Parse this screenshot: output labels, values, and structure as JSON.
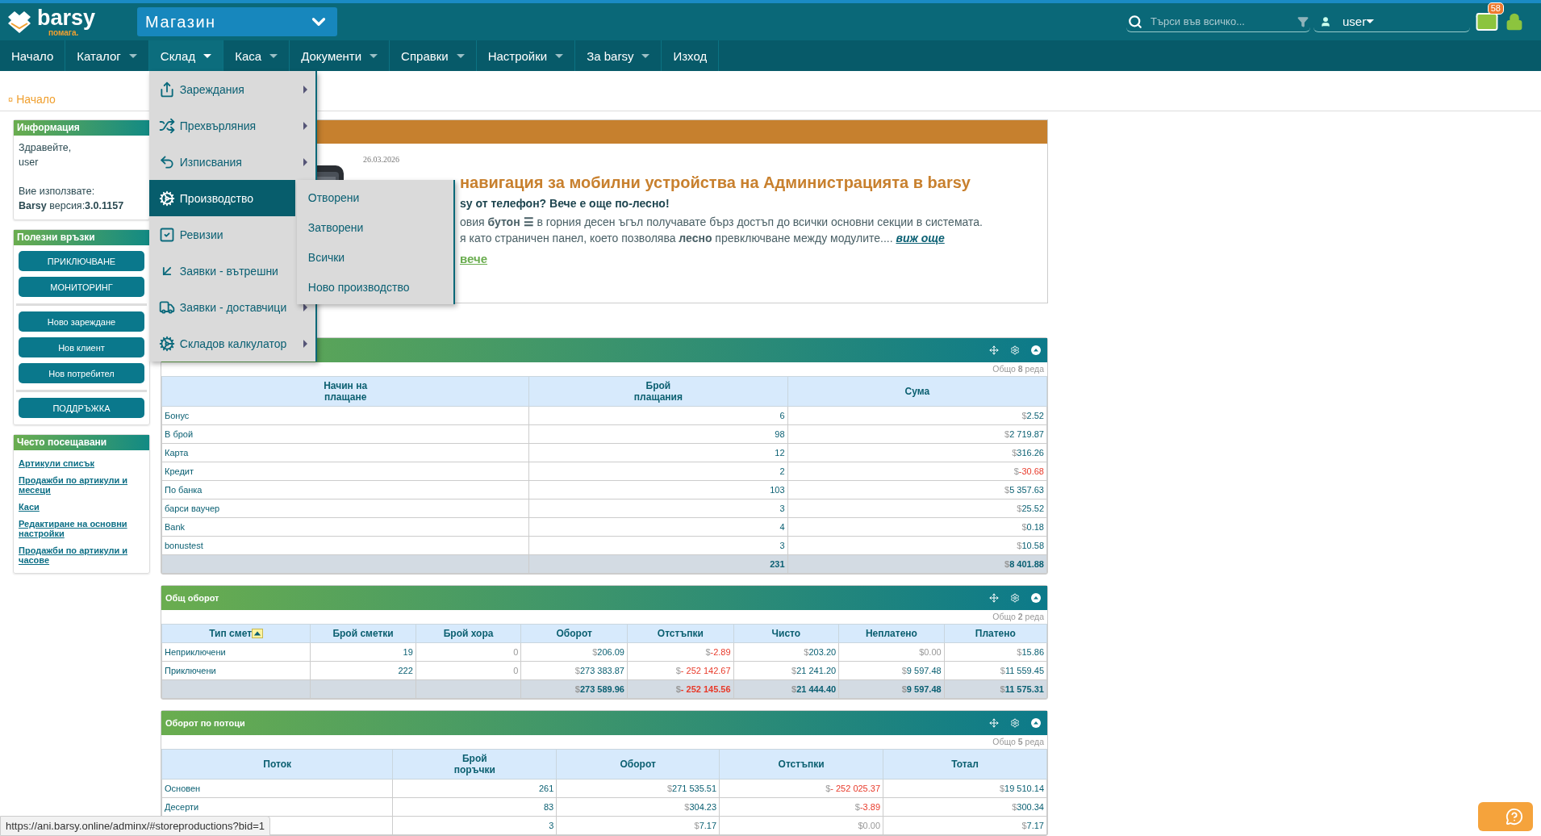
{
  "header": {
    "logo": {
      "name": "barsy",
      "tagline": "помага."
    },
    "store_select": {
      "value": "Магазин"
    },
    "search": {
      "placeholder": "Търси във всичко..."
    },
    "user": {
      "value": "user"
    },
    "messages_badge": "58"
  },
  "nav": [
    {
      "label": "Начало",
      "dropdown": false,
      "open": false
    },
    {
      "label": "Каталог",
      "dropdown": true,
      "open": false
    },
    {
      "label": "Склад",
      "dropdown": true,
      "open": true
    },
    {
      "label": "Каса",
      "dropdown": true,
      "open": false
    },
    {
      "label": "Документи",
      "dropdown": true,
      "open": false
    },
    {
      "label": "Справки",
      "dropdown": true,
      "open": false
    },
    {
      "label": "Настройки",
      "dropdown": true,
      "open": false
    },
    {
      "label": "За barsy",
      "dropdown": true,
      "open": false
    },
    {
      "label": "Изход",
      "dropdown": false,
      "open": false
    }
  ],
  "menu": {
    "items": [
      {
        "label": "Зареждания",
        "submenu": true,
        "selected": false
      },
      {
        "label": "Прехвърляния",
        "submenu": true,
        "selected": false
      },
      {
        "label": "Изписвания",
        "submenu": true,
        "selected": false
      },
      {
        "label": "Производство",
        "submenu": false,
        "selected": true
      },
      {
        "label": "Ревизии",
        "submenu": false,
        "selected": false
      },
      {
        "label": "Заявки - вътрешни",
        "submenu": false,
        "selected": false
      },
      {
        "label": "Заявки - доставчици",
        "submenu": true,
        "selected": false
      },
      {
        "label": "Складов калкулатор",
        "submenu": true,
        "selected": false
      }
    ]
  },
  "submenu": {
    "items": [
      {
        "label": "Отворени"
      },
      {
        "label": "Затворени"
      },
      {
        "label": "Всички"
      },
      {
        "label": "Ново производство"
      }
    ]
  },
  "breadcrumb": {
    "marker": "¤",
    "label": "Начало"
  },
  "sidebar": {
    "info": {
      "title": "Информация",
      "greeting": "Здравейте,",
      "user": "user",
      "using_label": "Вие използвате:",
      "version": "**Barsy** версия:**3.0.1157**"
    },
    "links": {
      "title": "Полезни връзки",
      "groups": [
        [
          "ПРИКЛЮЧВАНЕ",
          "МОНИТОРИНГ"
        ],
        [
          "Ново зареждане",
          "Нов клиент",
          "Нов потребител"
        ],
        [
          "ПОДДРЪЖКА"
        ]
      ]
    },
    "frequent": {
      "title": "Често посещавани",
      "links": [
        "Артикули списък",
        "Продажби по артикули и месеци",
        "Каси",
        "Редактиране на основни настройки",
        "Продажби по артикули и часове"
      ]
    }
  },
  "news": {
    "date": "26.03.2026",
    "title": "навигация за мобилни устройства на Администрацията в barsy",
    "subtitle": "sy от телефон? Вече е още по-лесно!",
    "body": [
      "овия **бутон ☰** в горния десен ъгъл получавате бърз достъп до всички основни секции в системата.",
      "я като страничен панел, което позволява **лесно** превключване между модулите...."
    ],
    "more_link": "виж още",
    "read_more": "вече"
  },
  "panels": [
    {
      "count": "Общо **8** реда",
      "columns": [
        {
          "label": "Начин на\nплащане"
        },
        {
          "label": "Брой\nплащания"
        },
        {
          "label": "Сума"
        }
      ],
      "rows": [
        [
          "Бонус",
          "6",
          {
            "kind": "money",
            "cur": "$",
            "amount": "2.52"
          }
        ],
        [
          "В брой",
          "98",
          {
            "kind": "money",
            "cur": "$",
            "amount": "2 719.87"
          }
        ],
        [
          "Карта",
          "12",
          {
            "kind": "money",
            "cur": "$",
            "amount": "316.26"
          }
        ],
        [
          "Кредит",
          "2",
          {
            "kind": "negative",
            "cur": "$",
            "amount": "-30.68"
          }
        ],
        [
          "По банка",
          "103",
          {
            "kind": "money",
            "cur": "$",
            "amount": "5 357.63"
          }
        ],
        [
          "барси ваучер",
          "3",
          {
            "kind": "money",
            "cur": "$",
            "amount": "25.52"
          }
        ],
        [
          "Bank",
          "4",
          {
            "kind": "money",
            "cur": "$",
            "amount": "0.18"
          }
        ],
        [
          "bonustest",
          "3",
          {
            "kind": "money",
            "cur": "$",
            "amount": "10.58"
          }
        ]
      ],
      "total": [
        "231",
        {
          "kind": "money",
          "cur": "$",
          "amount": "8 401.88"
        }
      ]
    },
    {
      "title": "Общ оборот",
      "count": "Общо **2** реда",
      "columns": [
        {
          "label": "Тип смет",
          "sorted": true
        },
        {
          "label": "Брой сметки",
          "sorted": false
        },
        {
          "label": "Брой хора",
          "sorted": false
        },
        {
          "label": "Оборот",
          "sorted": false
        },
        {
          "label": "Отстъпки",
          "sorted": false
        },
        {
          "label": "Чисто",
          "sorted": false
        },
        {
          "label": "Неплатено",
          "sorted": false
        },
        {
          "label": "Платено",
          "sorted": false
        }
      ],
      "rows": [
        [
          "Неприключени",
          "19",
          {
            "kind": "muted",
            "text": "0"
          },
          {
            "kind": "money",
            "cur": "$",
            "amount": "206.09"
          },
          {
            "kind": "negative",
            "cur": "$",
            "amount": "-2.89"
          },
          {
            "kind": "money",
            "cur": "$",
            "amount": "203.20"
          },
          {
            "kind": "muted",
            "cur": "$",
            "amount": "0.00"
          },
          {
            "kind": "money",
            "cur": "$",
            "amount": "15.86"
          }
        ],
        [
          "Приключени",
          "222",
          {
            "kind": "muted",
            "text": "0"
          },
          {
            "kind": "money",
            "cur": "$",
            "amount": "273 383.87"
          },
          {
            "kind": "negative",
            "cur": "$",
            "amount": "- 252 142.67"
          },
          {
            "kind": "money",
            "cur": "$",
            "amount": "21 241.20"
          },
          {
            "kind": "money",
            "cur": "$",
            "amount": "9 597.48"
          },
          {
            "kind": "money",
            "cur": "$",
            "amount": "11 559.45"
          }
        ]
      ],
      "total": [
        {
          "kind": "money",
          "cur": "$",
          "amount": "273 589.96"
        },
        {
          "kind": "negative",
          "cur": "$",
          "amount": "- 252 145.56"
        },
        {
          "kind": "money",
          "cur": "$",
          "amount": "21 444.40"
        },
        {
          "kind": "money",
          "cur": "$",
          "amount": "9 597.48"
        },
        {
          "kind": "money",
          "cur": "$",
          "amount": "11 575.31"
        }
      ]
    },
    {
      "title": "Оборот по потоци",
      "count": "Общо **5** реда",
      "columns": [
        {
          "label": "Поток"
        },
        {
          "label": "Брой\nпоръчки"
        },
        {
          "label": "Оборот"
        },
        {
          "label": "Отстъпки"
        },
        {
          "label": "Тотал"
        }
      ],
      "rows": [
        [
          "Основен",
          "261",
          {
            "kind": "money",
            "cur": "$",
            "amount": "271 535.51"
          },
          {
            "kind": "negative",
            "cur": "$",
            "amount": "- 252 025.37"
          },
          {
            "kind": "money",
            "cur": "$",
            "amount": "19 510.14"
          }
        ],
        [
          "Десерти",
          "83",
          {
            "kind": "money",
            "cur": "$",
            "amount": "304.23"
          },
          {
            "kind": "negative",
            "cur": "$",
            "amount": "-3.89"
          },
          {
            "kind": "money",
            "cur": "$",
            "amount": "300.34"
          }
        ],
        [
          "",
          "3",
          {
            "kind": "money",
            "cur": "$",
            "amount": "7.17"
          },
          {
            "kind": "muted",
            "cur": "$",
            "amount": "0.00"
          },
          {
            "kind": "money",
            "cur": "$",
            "amount": "7.17"
          }
        ]
      ]
    }
  ],
  "status_url": "https://ani.barsy.online/adminx/#storeproductions?bid=1"
}
